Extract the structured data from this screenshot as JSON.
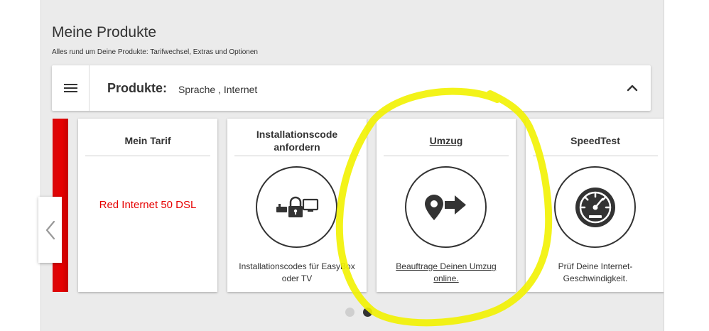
{
  "header": {
    "title": "Meine Produkte",
    "subtitle": "Alles rund um Deine Produkte: Tarifwechsel, Extras und Optionen"
  },
  "products_bar": {
    "label": "Produkte:",
    "value": "Sprache , Internet"
  },
  "cards": [
    {
      "title": "Mein Tarif",
      "value": "Red Internet 50 DSL"
    },
    {
      "title": "Installationscode anfordern",
      "description": "Installationscodes für EasyBox oder TV"
    },
    {
      "title": "Umzug",
      "description": "Beauftrage Deinen Umzug online."
    },
    {
      "title": "SpeedTest",
      "description": "Prüf Deine Internet-Geschwindigkeit."
    }
  ],
  "carousel": {
    "dots": 2,
    "active_dot": 2
  },
  "colors": {
    "brand_red": "#e60000",
    "panel_bg": "#ebebeb",
    "annotation_yellow": "#f2f200",
    "text": "#333333"
  },
  "icons": [
    "hamburger-icon",
    "chevron-up-icon",
    "chevron-left-icon",
    "lock-devices-icon",
    "location-arrow-icon",
    "speedometer-icon"
  ]
}
